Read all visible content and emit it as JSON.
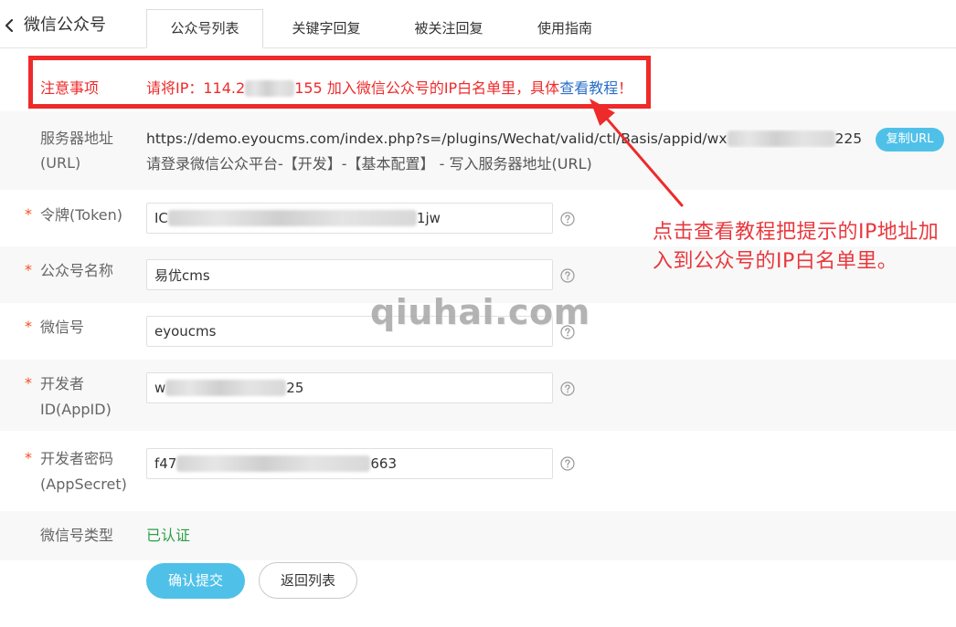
{
  "theme": {
    "accent": "#4fc1e9",
    "alert_red": "#ee2a2a",
    "link_blue": "#2c6fc7",
    "required_mark": "#f25022",
    "success_green": "#2c9f45",
    "annotation_red": "#e8383d"
  },
  "header": {
    "back_icon": "chevron-left-icon",
    "title": "微信公众号",
    "tabs": [
      {
        "label": "公众号列表",
        "active": true
      },
      {
        "label": "关键字回复",
        "active": false
      },
      {
        "label": "被关注回复",
        "active": false
      },
      {
        "label": "使用指南",
        "active": false
      }
    ]
  },
  "notice": {
    "label": "注意事项",
    "text_before_ip": "请将IP：114.2",
    "text_after_ip": "155 加入微信公众号的IP白名单里，具体",
    "link": "查看教程",
    "end": "！"
  },
  "form": {
    "required_mark": "*",
    "help_icon": "help-icon",
    "server_url": {
      "label": [
        "服务器地址",
        "(URL)"
      ],
      "url_visible_start": "https://demo.eyoucms.com/index.php?s=/plugins/Wechat/valid/ctl/Basis/appid/wx",
      "url_visible_end": "225",
      "copy_button": "复制URL",
      "hint": "请登录微信公众平台-【开发】-【基本配置】 - 写入服务器地址(URL)"
    },
    "token": {
      "required": true,
      "label": "令牌(Token)",
      "value_start": "IC",
      "value_end": "1jw"
    },
    "account_name": {
      "required": true,
      "label": "公众号名称",
      "value": "易优cms"
    },
    "wechat_id": {
      "required": true,
      "label": "微信号",
      "value": "eyoucms"
    },
    "app_id": {
      "required": true,
      "label": [
        "开发者",
        "ID(AppID)"
      ],
      "value_start": "w",
      "value_end": "25"
    },
    "app_secret": {
      "required": true,
      "label": [
        "开发者密码",
        "(AppSecret)"
      ],
      "value_start": "f47",
      "value_end": "663"
    },
    "account_type": {
      "label": "微信号类型",
      "value": "已认证"
    }
  },
  "actions": {
    "submit": "确认提交",
    "back": "返回列表"
  },
  "annotation": {
    "lines": [
      "点击查看教程把提示的IP地址加",
      "入到公众号的IP白名单里。"
    ]
  },
  "watermark": "qiuhai.com"
}
